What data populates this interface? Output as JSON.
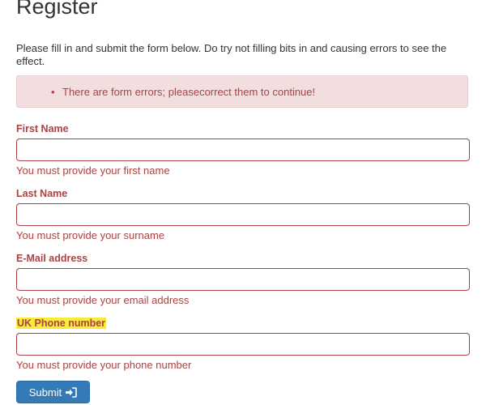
{
  "page": {
    "title": "Register",
    "intro": "Please fill in and submit the form below. Do try not filling bits in and causing errors to see the effect."
  },
  "alert": {
    "errors": [
      "There are form errors; pleasecorrect them to continue!"
    ]
  },
  "form": {
    "fields": [
      {
        "label": "First Name",
        "value": "",
        "error": "You must provide your first name"
      },
      {
        "label": "Last Name",
        "value": "",
        "error": "You must provide your surname"
      },
      {
        "label": "E-Mail address",
        "value": "",
        "error": "You must provide your email address"
      },
      {
        "label": "UK Phone number",
        "value": "",
        "error": "You must provide your phone number",
        "highlighted": true
      }
    ],
    "submit_label": "Submit",
    "submit_icon": "sign-in-icon"
  },
  "colors": {
    "error": "#a94442",
    "alert_bg": "#f2dede",
    "alert_border": "#ebccd1",
    "primary": "#337ab7",
    "highlight": "#f7ec3a"
  }
}
